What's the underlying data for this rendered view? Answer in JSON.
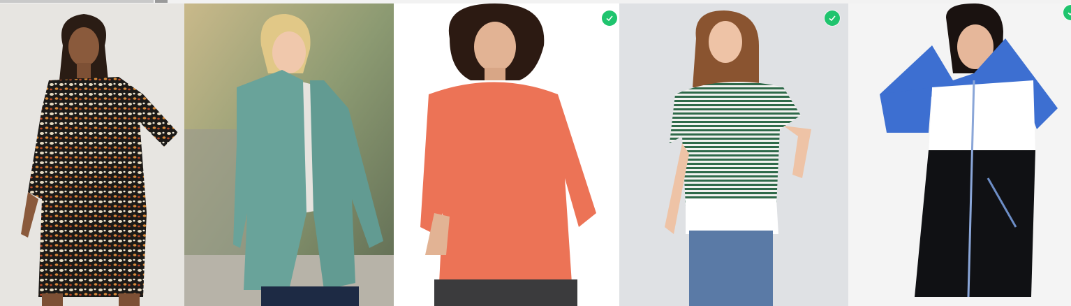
{
  "colors": {
    "check_badge": "#1fc46e",
    "top_strip": "#f2f2f2"
  },
  "products": [
    {
      "id": "p1",
      "selected": false,
      "icon": "check-icon"
    },
    {
      "id": "p2",
      "selected": false,
      "icon": "check-icon"
    },
    {
      "id": "p3",
      "selected": true,
      "icon": "check-icon"
    },
    {
      "id": "p4",
      "selected": true,
      "icon": "check-icon"
    },
    {
      "id": "p5",
      "selected": true,
      "icon": "check-icon"
    }
  ]
}
